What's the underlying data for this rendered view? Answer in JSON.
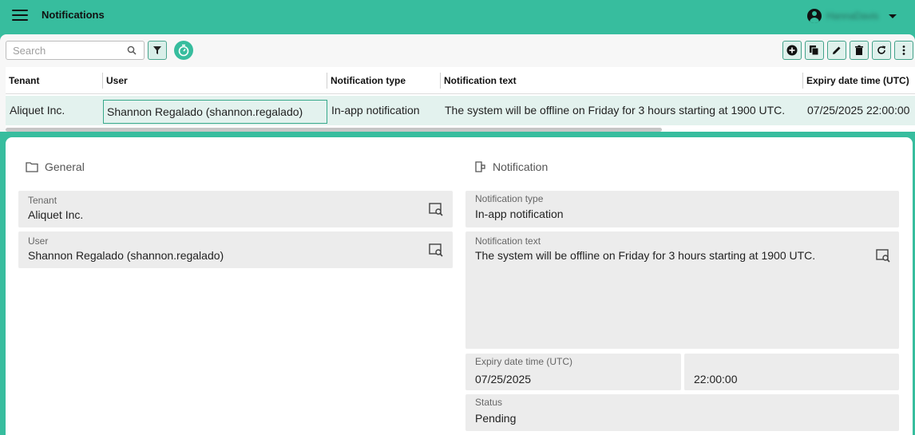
{
  "app": {
    "title": "Notifications",
    "username": "HannaDavis"
  },
  "toolbar": {
    "search_placeholder": "Search",
    "icons": [
      "search-icon",
      "filter-icon",
      "timer-icon",
      "add-icon",
      "copy-icon",
      "edit-icon",
      "delete-icon",
      "refresh-icon",
      "more-icon"
    ]
  },
  "grid": {
    "columns": [
      "Tenant",
      "User",
      "Notification type",
      "Notification text",
      "Expiry date time (UTC)"
    ],
    "rows": [
      {
        "tenant": "Aliquet Inc.",
        "user": "Shannon Regalado (shannon.regalado)",
        "type": "In-app notification",
        "text": "The system will be offline on Friday for 3 hours starting at 1900 UTC.",
        "expiry": "07/25/2025 22:00:00"
      }
    ]
  },
  "detail": {
    "general": {
      "title": "General",
      "tenant_label": "Tenant",
      "tenant_value": "Aliquet Inc.",
      "user_label": "User",
      "user_value": "Shannon Regalado (shannon.regalado)"
    },
    "notification": {
      "title": "Notification",
      "type_label": "Notification type",
      "type_value": "In-app notification",
      "text_label": "Notification text",
      "text_value": "The system will be offline on Friday for 3 hours starting at 1900 UTC.",
      "expiry_label": "Expiry date time (UTC)",
      "expiry_date": "07/25/2025",
      "expiry_time": "22:00:00",
      "status_label": "Status",
      "status_value": "Pending"
    }
  },
  "colors": {
    "accent": "#37bd9e",
    "selected_row": "#e3f2ee",
    "field_bg": "#ececec"
  }
}
